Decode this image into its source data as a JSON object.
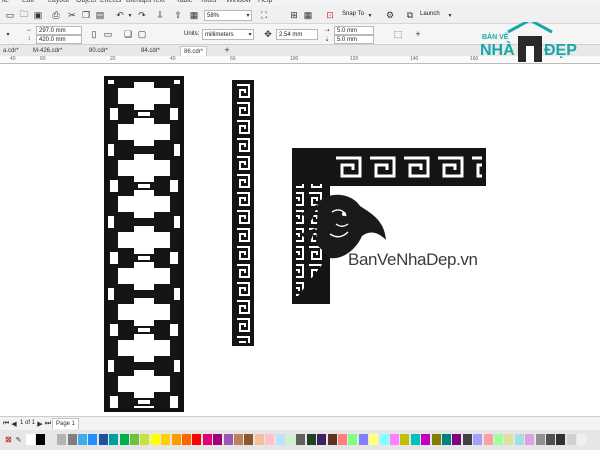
{
  "menubar": {
    "items": [
      "ile",
      "Edit",
      "Layout",
      "Object",
      "Effects",
      "Bitmaps",
      "Text",
      "Table",
      "Tools",
      "Window",
      "Help"
    ]
  },
  "toolbar": {
    "zoom": "58%",
    "snap_label": "Snap To",
    "launch_label": "Launch"
  },
  "propbar": {
    "width": "297.0 mm",
    "height": "420.0 mm",
    "units_label": "Units:",
    "units_value": "millimeters",
    "nudge": "2.54 mm",
    "dup_x": "5.0 mm",
    "dup_y": "5.0 mm"
  },
  "tabs": [
    {
      "label": "a.cdr*",
      "active": false
    },
    {
      "label": "M-426.cdr*",
      "active": false
    },
    {
      "label": "80.cdr*",
      "active": false
    },
    {
      "label": "84.cdr*",
      "active": false
    },
    {
      "label": "86.cdr*",
      "active": true
    }
  ],
  "ruler": {
    "ticks": [
      "40",
      "60",
      "20",
      "40",
      "60",
      "100",
      "120",
      "140",
      "160",
      "180"
    ]
  },
  "logo": {
    "top_text": "BẢN VẼ",
    "brand_left": "NHÀ",
    "brand_right": "ĐẸP"
  },
  "watermark": "BanVeNhaDep.vn",
  "statusbar": {
    "page_label": "Page 1",
    "page_counter": "1 of 1"
  },
  "colors": {
    "accent": "#1aa6a6",
    "palette": [
      "#ffffff",
      "#000000",
      "#e5e5e5",
      "#b3b3b3",
      "#7f7f7f",
      "#3daee9",
      "#1e90ff",
      "#2050a0",
      "#00a0a0",
      "#00b050",
      "#70c040",
      "#c8e040",
      "#ffff00",
      "#ffd000",
      "#ff9900",
      "#ff6600",
      "#ff0000",
      "#e0007a",
      "#a0007a",
      "#9b59b6",
      "#c08060",
      "#8b5a2b",
      "#f0c0a0",
      "#ffc0cb",
      "#c0e0ff",
      "#d0f0d0",
      "#606060",
      "#204020",
      "#402060",
      "#603020",
      "#ff8080",
      "#80ff80",
      "#8080ff",
      "#ffff80",
      "#80ffff",
      "#ff80ff",
      "#c0c000",
      "#00c0c0",
      "#c000c0",
      "#808000",
      "#008080",
      "#800080",
      "#404040",
      "#a0a0ff",
      "#ffa0a0",
      "#a0ffa0",
      "#e0e0a0",
      "#a0e0e0",
      "#e0a0e0",
      "#909090",
      "#505050",
      "#303030",
      "#d0d0d0",
      "#f0f0f0"
    ]
  }
}
